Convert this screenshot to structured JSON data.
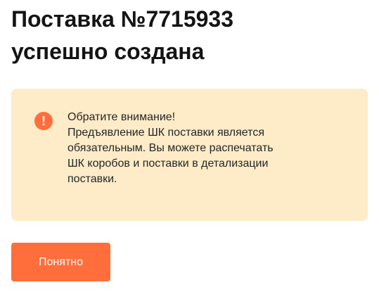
{
  "title": {
    "line1": "Поставка №7715933",
    "line2": "успешно создана"
  },
  "notice": {
    "icon": "exclamation-icon",
    "icon_glyph": "!",
    "icon_color": "#ff6e3b",
    "background_color": "#feebc8",
    "lines": [
      "Обратите внимание!",
      "Предъявление ШК поставки является",
      "обязательным. Вы можете распечатать",
      "ШК коробов и поставки в детализации",
      "поставки."
    ]
  },
  "actions": {
    "ok_label": "Понятно",
    "ok_color": "#ff6e3b"
  }
}
